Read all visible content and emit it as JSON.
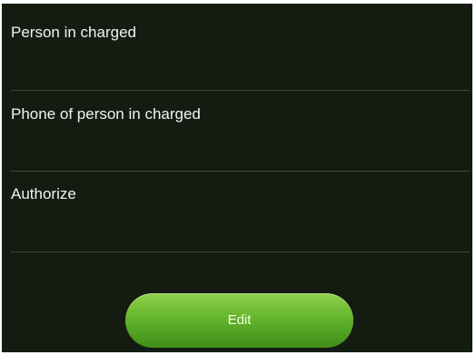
{
  "fields": [
    {
      "label": "Person in charged"
    },
    {
      "label": "Phone of person in charged"
    },
    {
      "label": "Authorize"
    }
  ],
  "actions": {
    "edit_label": "Edit"
  },
  "colors": {
    "background": "#141c12",
    "divider": "#3f463c",
    "text": "#f2f2f2",
    "button_top": "#8ed24a",
    "button_bottom": "#3f8d18"
  }
}
